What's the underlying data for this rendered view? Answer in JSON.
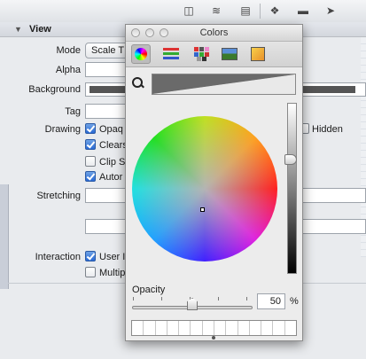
{
  "inspector": {
    "section_title": "View",
    "mode_label": "Mode",
    "mode_value": "Scale T",
    "alpha_label": "Alpha",
    "background_label": "Background",
    "tag_label": "Tag",
    "drawing_label": "Drawing",
    "drawing_options": [
      {
        "label": "Opaq",
        "checked": true
      },
      {
        "label": "Clears",
        "checked": true
      },
      {
        "label": "Clip S",
        "checked": false
      },
      {
        "label": "Autor",
        "checked": true
      }
    ],
    "hidden_label": "Hidden",
    "stretching_label": "Stretching",
    "interaction_label": "Interaction",
    "interaction_options": [
      {
        "label": "User I",
        "checked": true
      },
      {
        "label": "Multip",
        "checked": false
      }
    ]
  },
  "colors_panel": {
    "title": "Colors",
    "tabs": [
      "color-wheel",
      "color-sliders",
      "color-palettes",
      "image-palettes",
      "crayons"
    ],
    "selected_tab": "color-wheel",
    "opacity_label": "Opacity",
    "opacity_value": "50",
    "opacity_unit": "%",
    "opacity_level": 0.5,
    "brightness_level": 0.7
  }
}
